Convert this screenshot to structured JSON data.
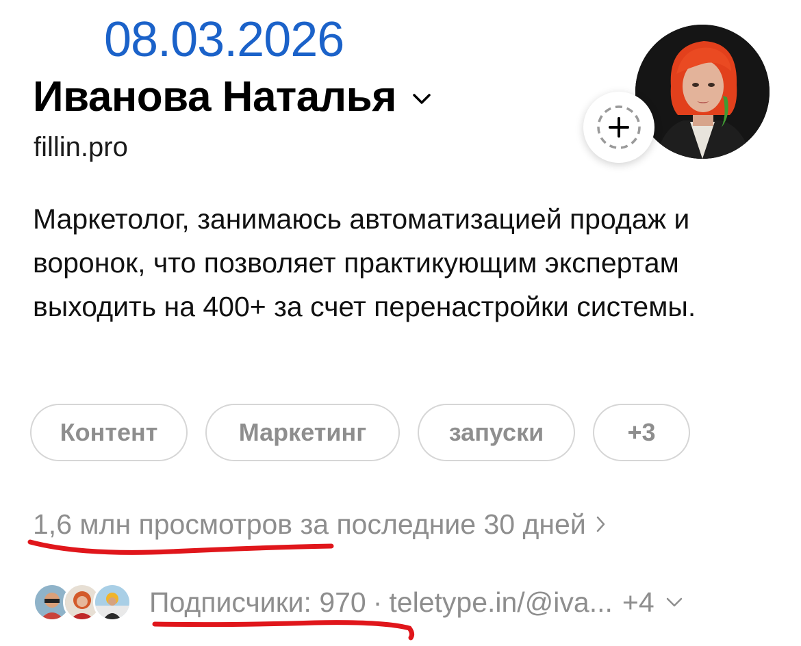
{
  "overlay": {
    "date": "08.03.2026"
  },
  "profile": {
    "name": "Иванова Наталья",
    "handle": "fillin.pro",
    "bio": "Маркетолог, занимаюсь автоматизацией продаж и воронок, что позволяет практикующим экспертам выходить на 400+ за счет перенастройки системы."
  },
  "tags": [
    "Контент",
    "Маркетинг",
    "запуски",
    "+3"
  ],
  "stats": {
    "views_text": "1,6 млн просмотров за последние 30 дней"
  },
  "followers": {
    "label": "Подписчики: 970",
    "separator": "·",
    "link": "teletype.in/@iva...",
    "more": "+4"
  },
  "colors": {
    "date": "#1b62c9",
    "annotation": "#e0161b",
    "muted_text": "#8e8e8e",
    "tag_border": "#d6d6d6",
    "avatar_hair": "#e2401c"
  },
  "icons": {
    "name_dropdown": "chevron-down-icon",
    "add_story": "plus-icon",
    "stats_arrow": "chevron-right-icon",
    "followers_dropdown": "chevron-down-icon"
  }
}
